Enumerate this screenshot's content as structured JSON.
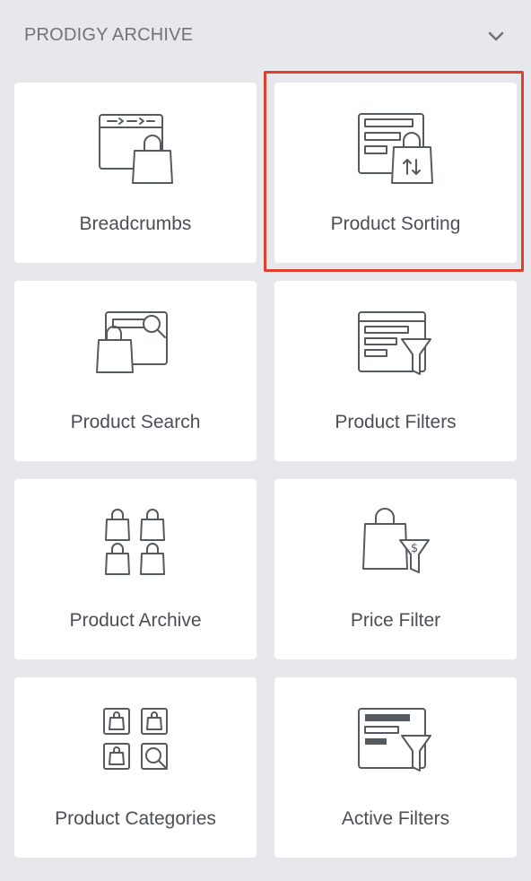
{
  "panel": {
    "title": "PRODIGY ARCHIVE",
    "collapse_icon": "chevron-down-icon",
    "selected_widget": "Product Sorting",
    "highlight_color": "#e0402b"
  },
  "widgets": [
    {
      "label": "Breadcrumbs",
      "icon": "breadcrumbs-icon"
    },
    {
      "label": "Product Sorting",
      "icon": "product-sorting-icon"
    },
    {
      "label": "Product Search",
      "icon": "product-search-icon"
    },
    {
      "label": "Product Filters",
      "icon": "product-filters-icon"
    },
    {
      "label": "Product Archive",
      "icon": "product-archive-icon"
    },
    {
      "label": "Price Filter",
      "icon": "price-filter-icon"
    },
    {
      "label": "Product Categories",
      "icon": "product-categories-icon"
    },
    {
      "label": "Active Filters",
      "icon": "active-filters-icon"
    }
  ]
}
